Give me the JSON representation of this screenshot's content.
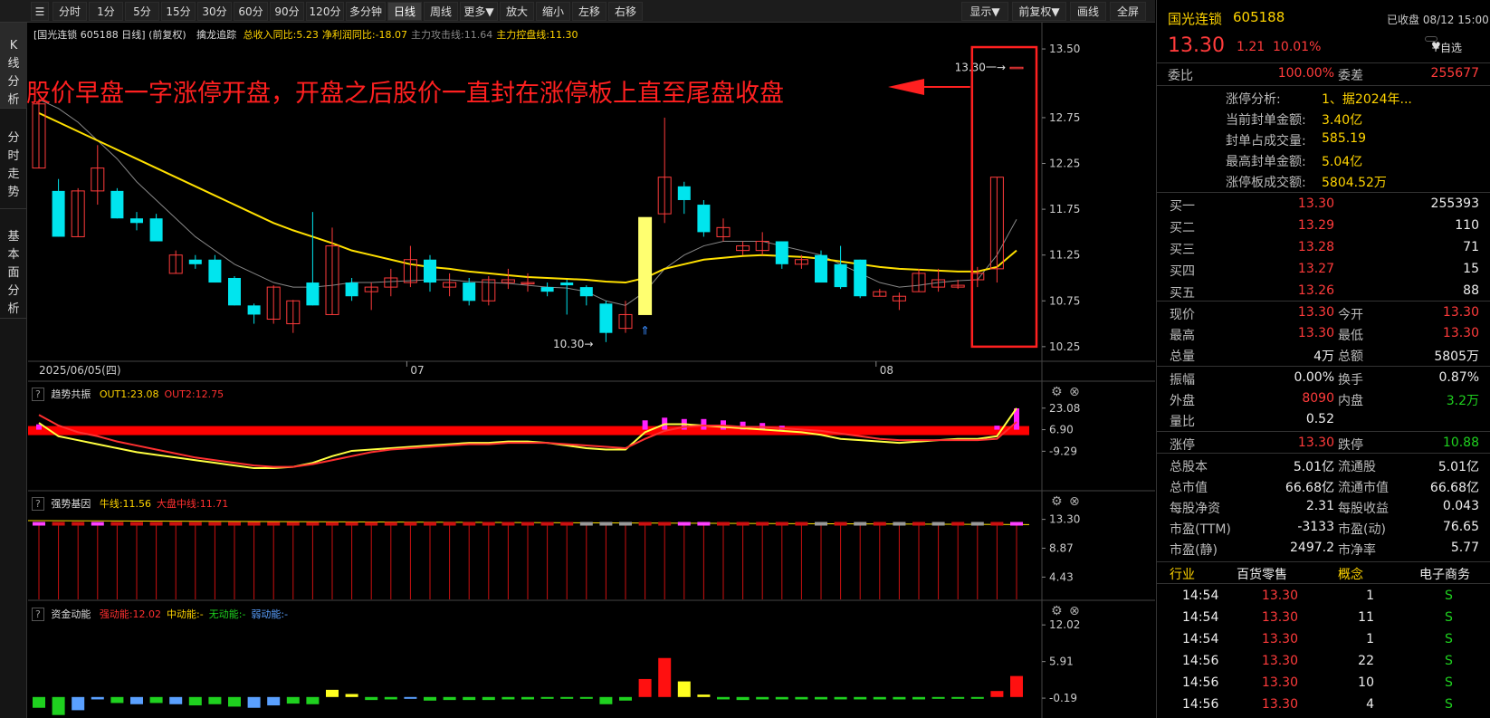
{
  "toolbar": {
    "buttons": [
      "分时",
      "1分",
      "5分",
      "15分",
      "30分",
      "60分",
      "90分",
      "120分",
      "多分钟",
      "日线",
      "周线",
      "更多▼",
      "放大",
      "缩小",
      "左移",
      "右移"
    ],
    "right_buttons": [
      "显示▼",
      "前复权▼",
      "画线",
      "全屏"
    ],
    "active": "日线"
  },
  "sidebar": {
    "items": [
      {
        "label": "K线分析"
      },
      {
        "label": "分时走势"
      },
      {
        "label": "基本面分析"
      }
    ]
  },
  "chart_header": {
    "title": "[国光连锁 605188 日线]",
    "adjust": "(前复权)",
    "indicator_name": "擒龙追踪",
    "items": [
      {
        "text": "总收入同比:5.23",
        "color": "#ffd400"
      },
      {
        "text": "净利润同比:-18.07",
        "color": "#ffd400"
      },
      {
        "text": "主力攻击线:11.64",
        "color": "#888888"
      },
      {
        "text": "主力控盘线:11.30",
        "color": "#ffd400"
      }
    ]
  },
  "annotation": {
    "text": "股价早盘一字涨停开盘，开盘之后股价一直封在涨停板上直至尾盘收盘",
    "color": "#ff2020"
  },
  "chart_data": [
    {
      "type": "candlestick",
      "name": "main",
      "y_ticks": [
        "13.50",
        "12.75",
        "12.25",
        "11.75",
        "11.25",
        "10.75",
        "10.25"
      ],
      "ylim": [
        10.13,
        13.55
      ],
      "x_labels": [
        "2025/06/05(四)",
        "07",
        "08"
      ],
      "marker_high": "13.30",
      "marker_low": "10.30",
      "candles": [
        {
          "o": 12.2,
          "c": 12.9,
          "h": 12.95,
          "l": 12.2
        },
        {
          "o": 11.95,
          "c": 11.45,
          "h": 12.08,
          "l": 11.45
        },
        {
          "o": 11.45,
          "c": 11.95,
          "h": 11.98,
          "l": 11.45
        },
        {
          "o": 11.95,
          "c": 12.2,
          "h": 12.45,
          "l": 11.8
        },
        {
          "o": 11.95,
          "c": 11.65,
          "h": 11.98,
          "l": 11.65
        },
        {
          "o": 11.65,
          "c": 11.6,
          "h": 11.72,
          "l": 11.52
        },
        {
          "o": 11.65,
          "c": 11.4,
          "h": 11.7,
          "l": 11.4
        },
        {
          "o": 11.05,
          "c": 11.25,
          "h": 11.3,
          "l": 11.05
        },
        {
          "o": 11.2,
          "c": 11.15,
          "h": 11.25,
          "l": 11.1
        },
        {
          "o": 11.2,
          "c": 10.95,
          "h": 11.25,
          "l": 10.95
        },
        {
          "o": 11.0,
          "c": 10.7,
          "h": 11.02,
          "l": 10.7
        },
        {
          "o": 10.7,
          "c": 10.6,
          "h": 10.72,
          "l": 10.5
        },
        {
          "o": 10.55,
          "c": 10.9,
          "h": 10.92,
          "l": 10.5
        },
        {
          "o": 10.5,
          "c": 10.75,
          "h": 10.76,
          "l": 10.4
        },
        {
          "o": 10.95,
          "c": 10.7,
          "h": 11.72,
          "l": 10.7
        },
        {
          "o": 10.6,
          "c": 11.35,
          "h": 11.55,
          "l": 10.6
        },
        {
          "o": 10.95,
          "c": 10.8,
          "h": 11.0,
          "l": 10.75
        },
        {
          "o": 10.85,
          "c": 10.9,
          "h": 10.95,
          "l": 10.65
        },
        {
          "o": 10.9,
          "c": 11.0,
          "h": 11.1,
          "l": 10.8
        },
        {
          "o": 10.95,
          "c": 11.2,
          "h": 11.35,
          "l": 10.9
        },
        {
          "o": 11.2,
          "c": 10.95,
          "h": 11.25,
          "l": 10.85
        },
        {
          "o": 10.9,
          "c": 10.95,
          "h": 11.05,
          "l": 10.8
        },
        {
          "o": 10.95,
          "c": 10.75,
          "h": 11.0,
          "l": 10.7
        },
        {
          "o": 10.75,
          "c": 10.98,
          "h": 11.02,
          "l": 10.7
        },
        {
          "o": 10.95,
          "c": 10.98,
          "h": 11.1,
          "l": 10.88
        },
        {
          "o": 10.95,
          "c": 10.95,
          "h": 11.05,
          "l": 10.85
        },
        {
          "o": 10.9,
          "c": 10.85,
          "h": 10.95,
          "l": 10.8
        },
        {
          "o": 10.95,
          "c": 10.92,
          "h": 10.98,
          "l": 10.6
        },
        {
          "o": 10.9,
          "c": 10.8,
          "h": 10.92,
          "l": 10.7
        },
        {
          "o": 10.72,
          "c": 10.4,
          "h": 10.75,
          "l": 10.3
        },
        {
          "o": 10.45,
          "c": 10.6,
          "h": 10.75,
          "l": 10.4
        },
        {
          "o": 10.6,
          "c": 11.66,
          "h": 11.66,
          "l": 10.6
        },
        {
          "o": 11.7,
          "c": 12.1,
          "h": 12.75,
          "l": 11.6
        },
        {
          "o": 12.0,
          "c": 11.85,
          "h": 12.05,
          "l": 11.7
        },
        {
          "o": 11.8,
          "c": 11.5,
          "h": 11.85,
          "l": 11.45
        },
        {
          "o": 11.45,
          "c": 11.55,
          "h": 11.65,
          "l": 11.4
        },
        {
          "o": 11.3,
          "c": 11.35,
          "h": 11.4,
          "l": 11.25
        },
        {
          "o": 11.3,
          "c": 11.4,
          "h": 11.5,
          "l": 11.25
        },
        {
          "o": 11.4,
          "c": 11.15,
          "h": 11.4,
          "l": 11.1
        },
        {
          "o": 11.15,
          "c": 11.2,
          "h": 11.25,
          "l": 11.1
        },
        {
          "o": 11.25,
          "c": 10.95,
          "h": 11.3,
          "l": 10.95
        },
        {
          "o": 11.15,
          "c": 10.9,
          "h": 11.35,
          "l": 10.88
        },
        {
          "o": 11.2,
          "c": 10.8,
          "h": 11.2,
          "l": 10.78
        },
        {
          "o": 10.8,
          "c": 10.85,
          "h": 10.88,
          "l": 10.8
        },
        {
          "o": 10.75,
          "c": 10.8,
          "h": 10.84,
          "l": 10.65
        },
        {
          "o": 10.85,
          "c": 11.05,
          "h": 11.1,
          "l": 10.85
        },
        {
          "o": 10.9,
          "c": 10.98,
          "h": 11.1,
          "l": 10.85
        },
        {
          "o": 10.9,
          "c": 10.92,
          "h": 10.98,
          "l": 10.88
        },
        {
          "o": 10.98,
          "c": 11.05,
          "h": 11.12,
          "l": 10.9
        },
        {
          "o": 11.1,
          "c": 12.1,
          "h": 12.1,
          "l": 10.95
        },
        {
          "o": 13.3,
          "c": 13.3,
          "h": 13.3,
          "l": 13.3
        }
      ],
      "ma_gray": [
        12.95,
        12.85,
        12.7,
        12.5,
        12.3,
        12.05,
        11.85,
        11.65,
        11.45,
        11.3,
        11.15,
        11.05,
        10.95,
        10.9,
        10.9,
        10.92,
        10.95,
        10.95,
        10.96,
        10.97,
        10.98,
        10.98,
        10.96,
        10.95,
        10.94,
        10.92,
        10.9,
        10.89,
        10.85,
        10.75,
        10.7,
        10.85,
        11.1,
        11.25,
        11.35,
        11.4,
        11.4,
        11.4,
        11.35,
        11.3,
        11.25,
        11.15,
        11.05,
        10.95,
        10.9,
        10.92,
        10.95,
        10.97,
        10.98,
        11.25,
        11.64
      ],
      "ma_yellow": [
        12.8,
        12.7,
        12.6,
        12.5,
        12.4,
        12.3,
        12.2,
        12.1,
        12.0,
        11.9,
        11.8,
        11.7,
        11.6,
        11.52,
        11.45,
        11.38,
        11.3,
        11.25,
        11.2,
        11.15,
        11.12,
        11.1,
        11.07,
        11.05,
        11.03,
        11.01,
        11.0,
        10.99,
        10.98,
        10.96,
        10.95,
        11.0,
        11.1,
        11.15,
        11.2,
        11.22,
        11.24,
        11.25,
        11.24,
        11.23,
        11.21,
        11.18,
        11.15,
        11.12,
        11.1,
        11.09,
        11.08,
        11.07,
        11.07,
        11.12,
        11.3
      ]
    },
    {
      "type": "line",
      "name": "趋势共振",
      "legend": [
        {
          "name": "OUT1:23.08",
          "color": "#ffd400"
        },
        {
          "name": "OUT2:12.75",
          "color": "#ff3030"
        }
      ],
      "y_ticks": [
        "23.08",
        "6.90",
        "-9.29"
      ],
      "ylim": [
        -24,
        27
      ],
      "series": [
        {
          "name": "OUT1",
          "color": "#ffff40",
          "values": [
            12,
            2,
            -1,
            -4,
            -7,
            -10,
            -12,
            -14,
            -16,
            -18,
            -20,
            -22,
            -22,
            -21,
            -18,
            -13,
            -9,
            -8,
            -7,
            -6,
            -5,
            -4,
            -3,
            -3,
            -2,
            -2,
            -3,
            -5,
            -7,
            -8,
            -8,
            5,
            11,
            11,
            10,
            9,
            8,
            7,
            6,
            5,
            3,
            0,
            -1,
            -2,
            -3,
            -2,
            -1,
            0,
            0,
            2,
            23.08
          ]
        },
        {
          "name": "OUT2",
          "color": "#ff3030",
          "values": [
            18,
            10,
            5,
            2,
            -2,
            -5,
            -8,
            -11,
            -14,
            -16,
            -18,
            -20,
            -21,
            -21,
            -19,
            -16,
            -13,
            -10,
            -8,
            -7,
            -6,
            -5,
            -4,
            -4,
            -3,
            -3,
            -3,
            -4,
            -5,
            -6,
            -7,
            0,
            6,
            9,
            10,
            10,
            9,
            9,
            8,
            7,
            6,
            4,
            2,
            0,
            -1,
            -1,
            -1,
            -1,
            -1,
            0,
            12.75
          ]
        }
      ],
      "bars": [
        4,
        0,
        0,
        0,
        0,
        0,
        0,
        0,
        0,
        0,
        0,
        0,
        0,
        0,
        0,
        0,
        0,
        0,
        0,
        0,
        0,
        0,
        0,
        0,
        0,
        0,
        0,
        0,
        0,
        0,
        0,
        7,
        9,
        8,
        8,
        7,
        6,
        5,
        3,
        0,
        0,
        0,
        0,
        0,
        0,
        0,
        0,
        0,
        0,
        3,
        16
      ]
    },
    {
      "type": "bar",
      "name": "强势基因",
      "legend": [
        {
          "name": "牛线:11.56",
          "color": "#ffd400"
        },
        {
          "name": "大盘中线:11.71",
          "color": "#ff3030"
        }
      ],
      "y_ticks": [
        "13.30",
        "8.87",
        "4.43"
      ],
      "ylim": [
        1.0,
        14.5
      ]
    },
    {
      "type": "bar",
      "name": "资金动能",
      "legend": [
        {
          "name": "强动能:12.02",
          "color": "#ff3030"
        },
        {
          "name": "中动能:-",
          "color": "#ffd400"
        },
        {
          "name": "无动能:-",
          "color": "#1fd11f"
        },
        {
          "name": "弱动能:-",
          "color": "#5aa0ff"
        }
      ],
      "y_ticks": [
        "12.02",
        "5.91",
        "-0.19"
      ],
      "ylim": [
        -3.5,
        12.5
      ],
      "values": [
        -1.8,
        -3.0,
        -2.2,
        -0.4,
        -1.0,
        -1.2,
        -1.0,
        -1.2,
        -1.4,
        -1.2,
        -1.6,
        -1.8,
        -1.4,
        -1.1,
        -1.2,
        1.2,
        0.5,
        -0.5,
        -0.4,
        -0.2,
        -0.6,
        -0.5,
        -0.5,
        -0.5,
        -0.4,
        -0.4,
        -0.3,
        -0.3,
        -0.3,
        -1.2,
        -0.6,
        3.0,
        6.5,
        2.6,
        0.4,
        -0.4,
        -0.5,
        -0.4,
        -0.4,
        -0.4,
        -0.4,
        -0.4,
        -0.4,
        -0.4,
        -0.4,
        -0.4,
        -0.3,
        -0.3,
        -0.2,
        1.0,
        3.5,
        12.02
      ],
      "colors": [
        "g",
        "g",
        "b",
        "b",
        "g",
        "b",
        "g",
        "b",
        "g",
        "g",
        "g",
        "b",
        "b",
        "g",
        "g",
        "y",
        "y",
        "g",
        "g",
        "b",
        "g",
        "g",
        "g",
        "g",
        "g",
        "g",
        "g",
        "g",
        "g",
        "g",
        "g",
        "r",
        "r",
        "y",
        "y",
        "g",
        "g",
        "g",
        "g",
        "g",
        "g",
        "g",
        "g",
        "g",
        "g",
        "g",
        "g",
        "g",
        "g",
        "r",
        "r",
        "r"
      ]
    }
  ],
  "panel": {
    "stock_name": "国光连锁",
    "stock_code": "605188",
    "status": "已收盘 08/12 15:00",
    "price": "13.30",
    "change": "1.21",
    "change_pct": "10.01%",
    "watch_label": "+自选",
    "weibi_label": "委比",
    "weibi": "100.00%",
    "weicha_label": "委差",
    "weicha": "255677",
    "limit_info": [
      {
        "label": "涨停分析:",
        "value": "1、据2024年..."
      },
      {
        "label": "当前封单金额:",
        "value": "3.40亿"
      },
      {
        "label": "封单占成交量:",
        "value": "585.19"
      },
      {
        "label": "最高封单金额:",
        "value": "5.04亿"
      },
      {
        "label": "涨停板成交额:",
        "value": "5804.52万"
      }
    ],
    "bids": [
      {
        "label": "买一",
        "price": "13.30",
        "vol": "255393"
      },
      {
        "label": "买二",
        "price": "13.29",
        "vol": "110"
      },
      {
        "label": "买三",
        "price": "13.28",
        "vol": "71"
      },
      {
        "label": "买四",
        "price": "13.27",
        "vol": "15"
      },
      {
        "label": "买五",
        "price": "13.26",
        "vol": "88"
      }
    ],
    "quote": [
      {
        "l1": "现价",
        "v1": "13.30",
        "c1": "red",
        "l2": "今开",
        "v2": "13.30",
        "c2": "red"
      },
      {
        "l1": "最高",
        "v1": "13.30",
        "c1": "red",
        "l2": "最低",
        "v2": "13.30",
        "c2": "red"
      },
      {
        "l1": "总量",
        "v1": "4万",
        "c1": "white",
        "l2": "总额",
        "v2": "5805万",
        "c2": "white"
      }
    ],
    "stats": [
      {
        "l1": "振幅",
        "v1": "0.00%",
        "c1": "white",
        "l2": "换手",
        "v2": "0.87%",
        "c2": "white"
      },
      {
        "l1": "外盘",
        "v1": "8090",
        "c1": "red",
        "l2": "内盘",
        "v2": "3.2万",
        "c2": "green"
      },
      {
        "l1": "量比",
        "v1": "0.52",
        "c1": "white",
        "l2": "",
        "v2": "",
        "c2": "white"
      }
    ],
    "limits": [
      {
        "l1": "涨停",
        "v1": "13.30",
        "c1": "red",
        "l2": "跌停",
        "v2": "10.88",
        "c2": "green"
      }
    ],
    "fundamentals": [
      {
        "l1": "总股本",
        "v1": "5.01亿",
        "l2": "流通股",
        "v2": "5.01亿"
      },
      {
        "l1": "总市值",
        "v1": "66.68亿",
        "l2": "流通市值",
        "v2": "66.68亿"
      },
      {
        "l1": "每股净资",
        "v1": "2.31",
        "l2": "每股收益",
        "v2": "0.043"
      },
      {
        "l1": "市盈(TTM)",
        "v1": "-3133",
        "l2": "市盈(动)",
        "v2": "76.65"
      },
      {
        "l1": "市盈(静)",
        "v1": "2497.2",
        "l2": "市净率",
        "v2": "5.77"
      }
    ],
    "industry": {
      "l1": "行业",
      "v1": "百货零售",
      "l2": "概念",
      "v2": "电子商务"
    },
    "ticks": [
      {
        "time": "14:54",
        "price": "13.30",
        "vol": "1",
        "side": "S"
      },
      {
        "time": "14:54",
        "price": "13.30",
        "vol": "11",
        "side": "S"
      },
      {
        "time": "14:54",
        "price": "13.30",
        "vol": "1",
        "side": "S"
      },
      {
        "time": "14:56",
        "price": "13.30",
        "vol": "22",
        "side": "S"
      },
      {
        "time": "14:56",
        "price": "13.30",
        "vol": "10",
        "side": "S"
      },
      {
        "time": "14:56",
        "price": "13.30",
        "vol": "4",
        "side": "S"
      }
    ]
  }
}
